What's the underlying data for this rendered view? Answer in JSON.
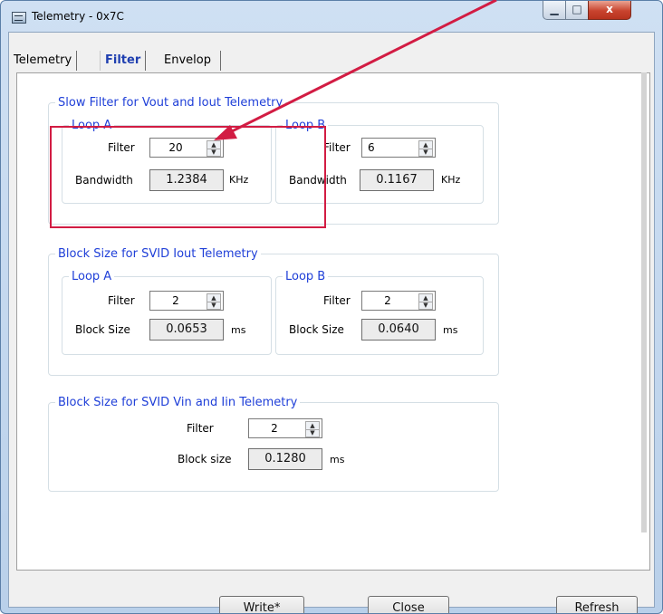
{
  "window": {
    "title": "Telemetry - 0x7C",
    "controls": {
      "minimize": "▁",
      "maximize": "□",
      "close": "x"
    }
  },
  "tabs": [
    {
      "label": "Telemetry"
    },
    {
      "label": "Filter"
    },
    {
      "label": "Envelop Detector"
    }
  ],
  "slow_filter": {
    "legend": "Slow Filter for Vout and Iout Telemetry",
    "loop_a": {
      "legend": "Loop A",
      "filter_label": "Filter",
      "filter_value": "20",
      "bandwidth_label": "Bandwidth",
      "bandwidth_value": "1.2384",
      "unit": "KHz"
    },
    "loop_b": {
      "legend": "Loop B",
      "filter_label": "Filter",
      "filter_value": "6",
      "bandwidth_label": "Bandwidth",
      "bandwidth_value": "0.1167",
      "unit": "KHz"
    }
  },
  "block_iout": {
    "legend": "Block Size for SVID Iout Telemetry",
    "loop_a": {
      "legend": "Loop A",
      "filter_label": "Filter",
      "filter_value": "2",
      "block_label": "Block Size",
      "block_value": "0.0653",
      "unit": "ms"
    },
    "loop_b": {
      "legend": "Loop B",
      "filter_label": "Filter",
      "filter_value": "2",
      "block_label": "Block Size",
      "block_value": "0.0640",
      "unit": "ms"
    }
  },
  "block_vin": {
    "legend": "Block Size for SVID Vin and Iin Telemetry",
    "filter_label": "Filter",
    "filter_value": "2",
    "block_label": "Block size",
    "block_value": "0.1280",
    "unit": "ms"
  },
  "buttons": {
    "write": "Write*",
    "close": "Close",
    "refresh": "Refresh"
  },
  "colors": {
    "annotation": "#d21c43",
    "legend_text": "#1f3fd8",
    "active_tab": "#1f3fb0"
  }
}
